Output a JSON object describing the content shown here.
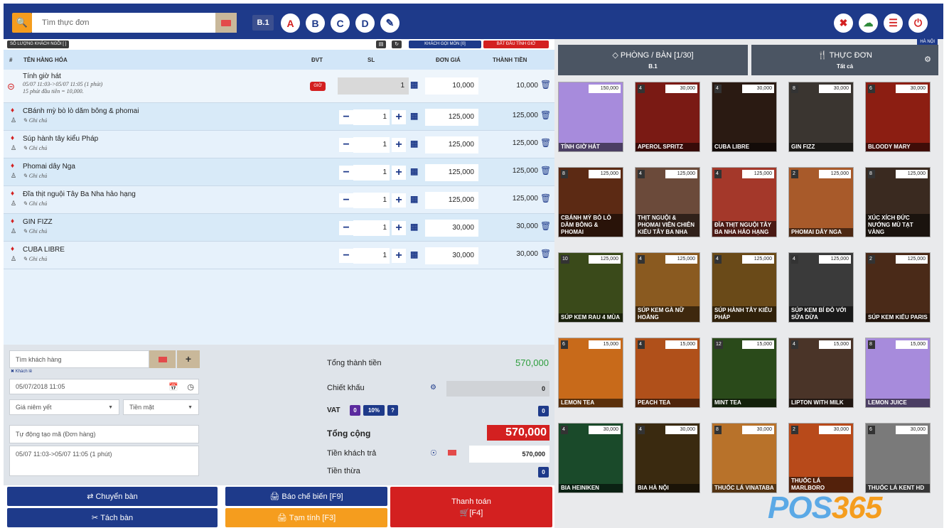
{
  "topbar": {
    "search_placeholder": "Tìm thực đơn",
    "table_tag": "B.1",
    "areas": [
      "A",
      "B",
      "C",
      "D"
    ]
  },
  "orders": {
    "guest_count_label": "SỐ LƯỢNG KHÁCH NGỒI [ ]",
    "order_by_customer_label": "KHÁCH GỌI MÓN [0]",
    "start_timer_label": "BẮT ĐẦU TÍNH GIỜ",
    "columns": {
      "no": "#",
      "name": "TÊN HÀNG HÓA",
      "unit": "ĐVT",
      "qty": "SL",
      "price": "ĐƠN GIÁ",
      "total": "THÀNH TIỀN"
    },
    "first": {
      "name": "Tính giờ hát",
      "note1": "05/07 11:03->05/07 11:05 (1 phút)",
      "note2": "15 phút đầu tiên = 10,000.",
      "unit": "GIỜ",
      "qty": "1",
      "price": "10,000",
      "total": "10,000"
    },
    "items": [
      {
        "name": "CBánh mỳ bò lò dăm bông & phomai",
        "note": "Ghi chú",
        "qty": "1",
        "price": "125,000",
        "total": "125,000"
      },
      {
        "name": "Súp hành tây kiểu Pháp",
        "note": "Ghi chú",
        "qty": "1",
        "price": "125,000",
        "total": "125,000"
      },
      {
        "name": "Phomai dây Nga",
        "note": "Ghi chú",
        "qty": "1",
        "price": "125,000",
        "total": "125,000"
      },
      {
        "name": "Đĩa thịt nguội Tây Ba Nha hảo hạng",
        "note": "Ghi chú",
        "qty": "1",
        "price": "125,000",
        "total": "125,000"
      },
      {
        "name": "GIN FIZZ",
        "note": "Ghi chú",
        "qty": "1",
        "price": "30,000",
        "total": "30,000"
      },
      {
        "name": "CUBA LIBRE",
        "note": "Ghi chú",
        "qty": "1",
        "price": "30,000",
        "total": "30,000"
      }
    ]
  },
  "customer": {
    "search_placeholder": "Tìm khách hàng",
    "guest_label": "Khách lẻ",
    "datetime": "05/07/2018 11:05",
    "price_list": "Giá niêm yết",
    "payment_method": "Tiền mặt",
    "order_code_placeholder": "Tự động tạo mã (Đơn hàng)",
    "note": "05/07 11:03->05/07 11:05 (1 phút)"
  },
  "summary": {
    "subtotal_label": "Tổng thành tiền",
    "subtotal": "570,000",
    "discount_label": "Chiết khấu",
    "discount": "0",
    "vat_label": "VAT",
    "vat_value": "0",
    "vat_rate": "10%",
    "vat_help": "?",
    "vat_amount": "0",
    "grand_total_label": "Tổng cộng",
    "grand_total": "570,000",
    "paid_label": "Tiền khách trả",
    "paid": "570,000",
    "change_label": "Tiền thừa",
    "change": "0"
  },
  "buttons": {
    "transfer": "Chuyển bàn",
    "split": "Tách bàn",
    "kitchen": "Báo chế biến [F9]",
    "provisional": "Tạm tính [F3]",
    "pay": "Thanh toán",
    "pay_key": "[F4]"
  },
  "right": {
    "area_label": "HÀ NỘI",
    "rooms_label": "PHÒNG / BÀN [1/30]",
    "rooms_value": "B.1",
    "menu_label": "THỰC ĐƠN",
    "menu_value": "Tất cả",
    "products": [
      {
        "name": "TÍNH GIỜ HÁT",
        "qty": "",
        "price": "150,000",
        "color": "#a78bdc"
      },
      {
        "name": "APEROL SPRITZ",
        "qty": "4",
        "price": "30,000",
        "color": "#7a1a14"
      },
      {
        "name": "CUBA LIBRE",
        "qty": "4",
        "price": "30,000",
        "color": "#2a1a12"
      },
      {
        "name": "GIN FIZZ",
        "qty": "8",
        "price": "30,000",
        "color": "#3a3530"
      },
      {
        "name": "BLOODY MARY",
        "qty": "6",
        "price": "30,000",
        "color": "#8c1e12"
      },
      {
        "name": "CBÁNH MỲ BÒ LÒ DĂM BÔNG & PHOMAI",
        "qty": "8",
        "price": "125,000",
        "color": "#5c2a14"
      },
      {
        "name": "THỊT NGUỘI & PHOMAI VIÊN CHIÊN KIỂU TÂY BA NHA",
        "qty": "4",
        "price": "125,000",
        "color": "#6b4a3a"
      },
      {
        "name": "ĐĨA THỊT NGUỘI TÂY BA NHA HẢO HẠNG",
        "qty": "4",
        "price": "125,000",
        "color": "#a4382a"
      },
      {
        "name": "PHOMAI DÂY NGA",
        "qty": "2",
        "price": "125,000",
        "color": "#a85a2a"
      },
      {
        "name": "XÚC XÍCH ĐỨC NƯỚNG MÙ TẠT VÀNG",
        "qty": "8",
        "price": "125,000",
        "color": "#3a2a20"
      },
      {
        "name": "SÚP KEM RAU 4 MÙA",
        "qty": "10",
        "price": "125,000",
        "color": "#3a4a1a"
      },
      {
        "name": "SÚP KEM GÀ NỮ HOÀNG",
        "qty": "4",
        "price": "125,000",
        "color": "#8a5a20"
      },
      {
        "name": "SÚP HÀNH TÂY KIỂU PHÁP",
        "qty": "4",
        "price": "125,000",
        "color": "#6a4a18"
      },
      {
        "name": "SÚP KEM BÍ ĐỎ VỚI SỮA DỪA",
        "qty": "4",
        "price": "125,000",
        "color": "#3a3a3a"
      },
      {
        "name": "SÚP KEM KIỂU PARIS",
        "qty": "2",
        "price": "125,000",
        "color": "#4a2a18"
      },
      {
        "name": "LEMON TEA",
        "qty": "6",
        "price": "15,000",
        "color": "#c86a1a"
      },
      {
        "name": "PEACH TEA",
        "qty": "4",
        "price": "15,000",
        "color": "#b0501a"
      },
      {
        "name": "MINT TEA",
        "qty": "12",
        "price": "15,000",
        "color": "#2a4a1a"
      },
      {
        "name": "LIPTON WITH MILK",
        "qty": "4",
        "price": "15,000",
        "color": "#4a3428"
      },
      {
        "name": "LEMON JUICE",
        "qty": "8",
        "price": "15,000",
        "color": "#a78bdc"
      },
      {
        "name": "BIA HEINIKEN",
        "qty": "4",
        "price": "30,000",
        "color": "#1a4a2a"
      },
      {
        "name": "BIA HÀ NỘI",
        "qty": "4",
        "price": "30,000",
        "color": "#3a2a10"
      },
      {
        "name": "THUỐC LÁ VINATABA",
        "qty": "8",
        "price": "30,000",
        "color": "#b8722a"
      },
      {
        "name": "THUỐC LÁ MARLBORO",
        "qty": "2",
        "price": "30,000",
        "color": "#b84a1a"
      },
      {
        "name": "THUỐC LÁ KENT HD",
        "qty": "6",
        "price": "30,000",
        "color": "#7a7a7a"
      }
    ]
  },
  "brand": {
    "logo_a": "POS",
    "logo_b": "365"
  }
}
